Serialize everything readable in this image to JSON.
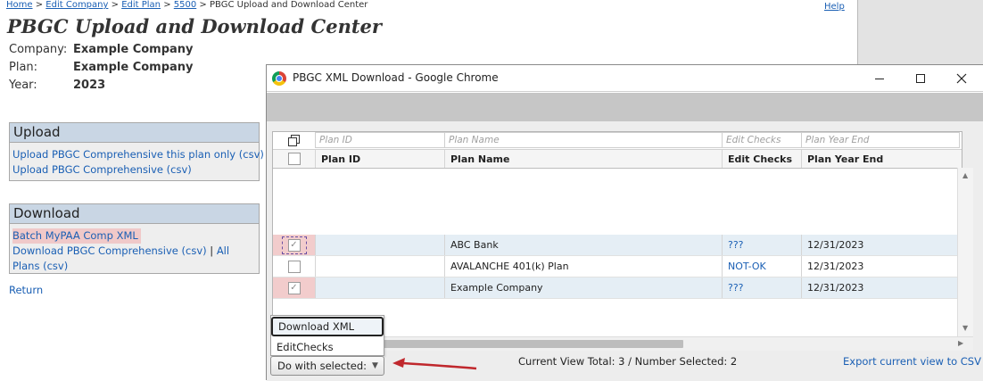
{
  "breadcrumb": {
    "items": [
      "Home",
      "Edit Company",
      "Edit Plan",
      "5500"
    ],
    "current": "PBGC Upload and Download Center",
    "separator": ">"
  },
  "help_label": "Help",
  "page_title": "PBGC Upload and Download Center",
  "info": {
    "company_label": "Company:",
    "company_value": "Example Company",
    "plan_label": "Plan:",
    "plan_value": "Example Company",
    "year_label": "Year:",
    "year_value": "2023"
  },
  "upload_panel": {
    "title": "Upload",
    "links": [
      "Upload PBGC Comprehensive this plan only (csv)",
      "Upload PBGC Comprehensive (csv)"
    ]
  },
  "download_panel": {
    "title": "Download",
    "batch_link": "Batch MyPAA Comp XML",
    "pbgc_link": "Download PBGC Comprehensive (csv)",
    "divider": "|",
    "all_plans_link": "All Plans (csv)"
  },
  "return_label": "Return",
  "popup": {
    "window_title": "PBGC XML Download - Google Chrome",
    "icons": {
      "minimize": "minimize-icon",
      "maximize": "maximize-icon",
      "close": "close-icon",
      "app": "chrome-icon"
    },
    "filters": {
      "plan_id": "Plan ID",
      "plan_name": "Plan Name",
      "edit_checks": "Edit Checks",
      "plan_year_end": "Plan Year End"
    },
    "columns": {
      "plan_id": "Plan ID",
      "plan_name": "Plan Name",
      "edit_checks": "Edit Checks",
      "plan_year_end": "Plan Year End"
    },
    "rows": [
      {
        "plan_id": "",
        "plan_name": "ABC Bank",
        "edit_checks": "???",
        "plan_year_end": "12/31/2023",
        "selected": true
      },
      {
        "plan_id": "",
        "plan_name": "AVALANCHE 401(k) Plan",
        "edit_checks": "NOT-OK",
        "plan_year_end": "12/31/2023",
        "selected": false
      },
      {
        "plan_id": "",
        "plan_name": "Example Company",
        "edit_checks": "???",
        "plan_year_end": "12/31/2023",
        "selected": true
      }
    ],
    "menu_items": [
      "Download XML",
      "EditChecks"
    ],
    "do_with_selected": "Do with selected:",
    "status": "Current View Total: 3 / Number Selected: 2",
    "export_label": "Export current view to CSV"
  },
  "colors": {
    "link": "#1a5fb4",
    "selected_row_highlight": "#f2cccc",
    "panel_header": "#c9d6e4",
    "arrow": "#c0282d"
  }
}
